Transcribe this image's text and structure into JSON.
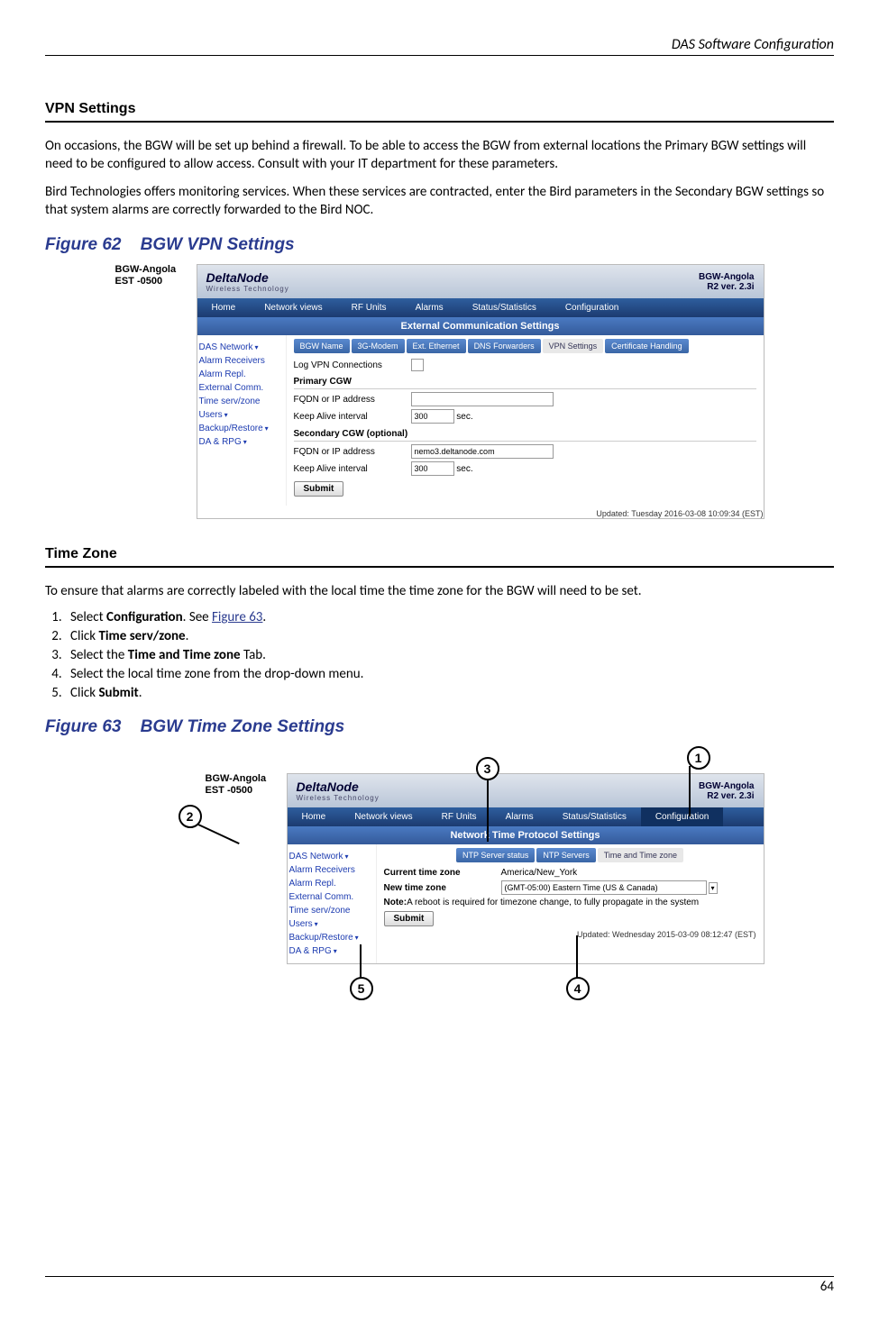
{
  "header": {
    "running_title": "DAS Software Configuration",
    "page_number": "64"
  },
  "section_vpn": {
    "title": "VPN Settings",
    "p1": "On occasions, the BGW will be set up behind a firewall. To be able to access the BGW from external locations the Primary BGW settings will need to be configured to allow access. Consult with your IT department for these parameters.",
    "p2": "Bird Technologies offers monitoring services. When these services are contracted, enter the Bird parameters in the Secondary BGW settings so that system alarms are correctly forwarded to the Bird NOC."
  },
  "figure62": {
    "caption_prefix": "Figure 62",
    "caption_title": "BGW VPN Settings",
    "device_name": "BGW-Angola",
    "device_tz": "EST -0500",
    "brand": "DeltaNode",
    "brand_sub": "Wireless   Technology",
    "unit_title": "BGW-Angola",
    "unit_ver": "R2 ver. 2.3i",
    "nav": [
      "Home",
      "Network views",
      "RF Units",
      "Alarms",
      "Status/Statistics",
      "Configuration"
    ],
    "panel_title": "External Communication Settings",
    "side_items": [
      {
        "label": "DAS Network",
        "drop": true
      },
      {
        "label": "Alarm Receivers",
        "drop": false
      },
      {
        "label": "Alarm Repl.",
        "drop": false
      },
      {
        "label": "External Comm.",
        "drop": false
      },
      {
        "label": "Time serv/zone",
        "drop": false
      },
      {
        "label": "Users",
        "drop": true
      },
      {
        "label": "Backup/Restore",
        "drop": true
      },
      {
        "label": "DA & RPG",
        "drop": true
      }
    ],
    "subtabs": [
      "BGW Name",
      "3G-Modem",
      "Ext. Ethernet",
      "DNS Forwarders",
      "VPN Settings",
      "Certificate Handling"
    ],
    "subtab_active": 4,
    "form": {
      "log_label": "Log VPN Connections",
      "primary_label": "Primary CGW",
      "fqdn_label": "FQDN or IP address",
      "fqdn_value": "",
      "keepalive_label": "Keep Alive interval",
      "keepalive_value": "300",
      "keepalive_unit": "sec.",
      "secondary_label": "Secondary CGW (optional)",
      "sec_fqdn_value": "nemo3.deltanode.com",
      "sec_keepalive_value": "300",
      "submit": "Submit"
    },
    "updated": "Updated: Tuesday 2016-03-08 10:09:34 (EST)"
  },
  "section_tz": {
    "title": "Time Zone",
    "intro": "To ensure that alarms are correctly labeled with the local time the time zone for the BGW will need to be set.",
    "steps": [
      {
        "pre": "Select ",
        "bold": "Configuration",
        "post": ". See ",
        "link": "Figure 63",
        "tail": "."
      },
      {
        "pre": "Click ",
        "bold": "Time serv/zone",
        "post": ".",
        "link": "",
        "tail": ""
      },
      {
        "pre": "Select the ",
        "bold": "Time and Time zone",
        "post": " Tab.",
        "link": "",
        "tail": ""
      },
      {
        "pre": "Select the local time zone from the drop-down menu.",
        "bold": "",
        "post": "",
        "link": "",
        "tail": ""
      },
      {
        "pre": "Click ",
        "bold": "Submit",
        "post": ".",
        "link": "",
        "tail": ""
      }
    ]
  },
  "figure63": {
    "caption_prefix": "Figure 63",
    "caption_title": "BGW Time Zone Settings",
    "device_name": "BGW-Angola",
    "device_tz": "EST -0500",
    "brand": "DeltaNode",
    "brand_sub": "Wireless   Technology",
    "unit_title": "BGW-Angola",
    "unit_ver": "R2 ver. 2.3i",
    "nav": [
      "Home",
      "Network views",
      "RF Units",
      "Alarms",
      "Status/Statistics",
      "Configuration"
    ],
    "nav_active": 5,
    "panel_title": "Network Time Protocol Settings",
    "side_items": [
      {
        "label": "DAS Network",
        "drop": true
      },
      {
        "label": "Alarm Receivers",
        "drop": false
      },
      {
        "label": "Alarm Repl.",
        "drop": false
      },
      {
        "label": "External Comm.",
        "drop": false
      },
      {
        "label": "Time serv/zone",
        "drop": false
      },
      {
        "label": "Users",
        "drop": true
      },
      {
        "label": "Backup/Restore",
        "drop": true
      },
      {
        "label": "DA & RPG",
        "drop": true
      }
    ],
    "subtabs": [
      "NTP Server status",
      "NTP Servers",
      "Time and Time zone"
    ],
    "subtab_active": 2,
    "form": {
      "cur_label": "Current time zone",
      "cur_value": "America/New_York",
      "new_label": "New time zone",
      "new_value": "(GMT-05:00) Eastern Time (US & Canada)",
      "note_label": "Note:",
      "note_text": " A reboot is required for timezone change, to fully propagate in the system",
      "submit": "Submit"
    },
    "updated": "Updated: Wednesday 2015-03-09 08:12:47 (EST)",
    "callouts": {
      "c1": "1",
      "c2": "2",
      "c3": "3",
      "c4": "4",
      "c5": "5"
    }
  }
}
